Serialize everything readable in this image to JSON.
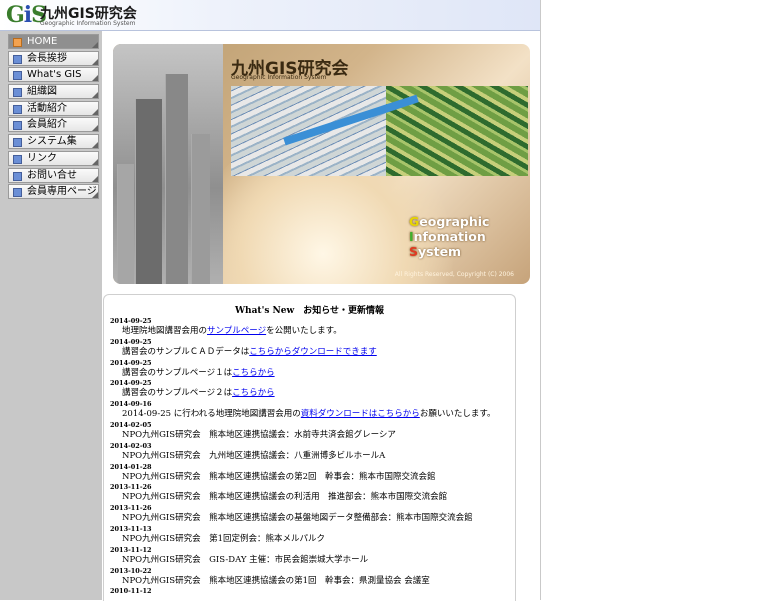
{
  "header": {
    "logo_mark_g": "G",
    "logo_mark_i": "i",
    "logo_mark_s": "S",
    "title": "九州GIS研究会",
    "subtitle": "Geographic Information System"
  },
  "sidebar": {
    "items": [
      {
        "label": "HOME",
        "active": true
      },
      {
        "label": "会長挨拶"
      },
      {
        "label": "What's GIS"
      },
      {
        "label": "組織図"
      },
      {
        "label": "活動紹介"
      },
      {
        "label": "会員紹介"
      },
      {
        "label": "システム集"
      },
      {
        "label": "リンク"
      },
      {
        "label": "お問い合せ"
      },
      {
        "label": "会員専用ページ"
      }
    ]
  },
  "banner": {
    "title": "九州GIS研究会",
    "subtitle": "Geographic Information System",
    "gis_lines": [
      {
        "first": "G",
        "rest": "eographic"
      },
      {
        "first": "I",
        "rest": "nfomation"
      },
      {
        "first": "S",
        "rest": "ystem"
      }
    ],
    "copyright": "All Rights Reserved, Copyright (C) 2006"
  },
  "news": {
    "title": "What's New　お知らせ・更新情報",
    "entries": [
      {
        "date": "2014-09-25",
        "before": "地理院地図講習会用の",
        "link": "サンプルページ",
        "after": "を公開いたします。"
      },
      {
        "date": "2014-09-25",
        "before": "講習会のサンプルＣＡＤデータは",
        "link": "こちらからダウンロードできます",
        "after": ""
      },
      {
        "date": "2014-09-25",
        "before": "講習会のサンプルページ１は",
        "link": "こちらから",
        "after": ""
      },
      {
        "date": "2014-09-25",
        "before": "講習会のサンプルページ２は",
        "link": "こちらから",
        "after": ""
      },
      {
        "date": "2014-09-16",
        "before": "2014-09-25 に行われる地理院地図講習会用の",
        "link": "資料ダウンロードはこちらから",
        "after": "お願いいたします。"
      },
      {
        "date": "2014-02-05",
        "before": "NPO九州GIS研究会　熊本地区連携協議会：水前寺共済会館グレーシア",
        "link": "",
        "after": ""
      },
      {
        "date": "2014-02-03",
        "before": "NPO九州GIS研究会　九州地区連携協議会：八重洲博多ビルホールA",
        "link": "",
        "after": ""
      },
      {
        "date": "2014-01-28",
        "before": "NPO九州GIS研究会　熊本地区連携協議会の第2回　幹事会：熊本市国際交流会館",
        "link": "",
        "after": ""
      },
      {
        "date": "2013-11-26",
        "before": "NPO九州GIS研究会　熊本地区連携協議会の利活用　推進部会：熊本市国際交流会館",
        "link": "",
        "after": ""
      },
      {
        "date": "2013-11-26",
        "before": "NPO九州GIS研究会　熊本地区連携協議会の基盤地図データ整備部会：熊本市国際交流会館",
        "link": "",
        "after": ""
      },
      {
        "date": "2013-11-13",
        "before": "NPO九州GIS研究会　第1回定例会：熊本メルパルク",
        "link": "",
        "after": ""
      },
      {
        "date": "2013-11-12",
        "before": "NPO九州GIS研究会　GIS-DAY 主催：市民会館崇城大学ホール",
        "link": "",
        "after": ""
      },
      {
        "date": "2013-10-22",
        "before": "NPO九州GIS研究会　熊本地区連携協議会の第1回　幹事会：県測量協会 会議室",
        "link": "",
        "after": ""
      },
      {
        "date": "2010-11-12",
        "before": "",
        "link": "",
        "after": ""
      }
    ]
  },
  "colors": {
    "sidebar_bg": "#c8c8c8",
    "menu_active_bg": "#8f8f8f",
    "bullet_active": "#f3a24f",
    "bullet": "#6b8fd6",
    "link": "#0000ee"
  }
}
